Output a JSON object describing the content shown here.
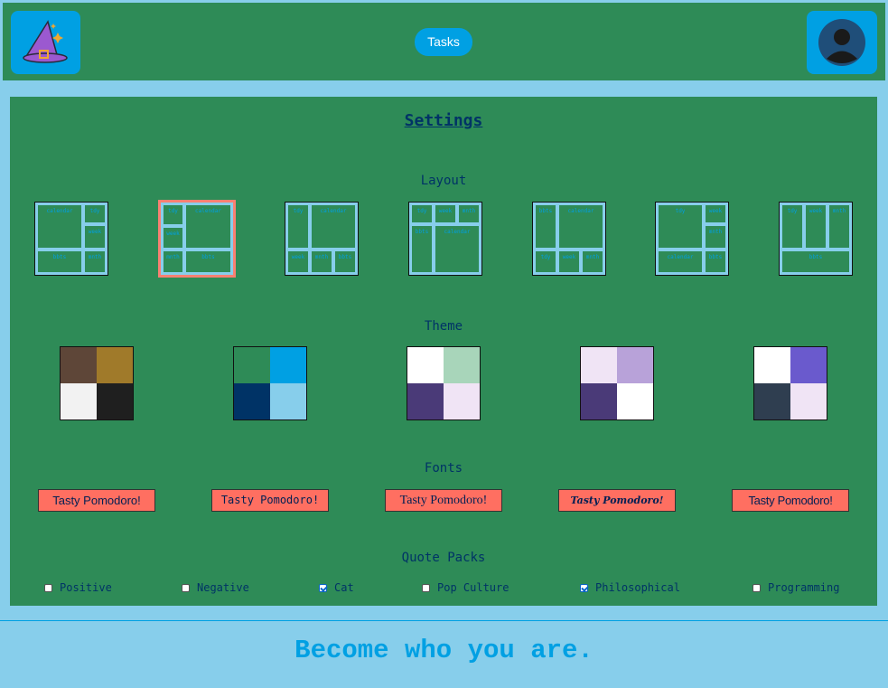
{
  "header": {
    "logo_icon": "wizard-hat-icon",
    "tasks_label": "Tasks",
    "avatar_icon": "user-avatar-icon"
  },
  "settings": {
    "title": "Settings",
    "layout_title": "Layout",
    "theme_title": "Theme",
    "fonts_title": "Fonts",
    "quote_packs_title": "Quote Packs"
  },
  "layouts": [
    {
      "cells": [
        "calendar",
        "tdy",
        "week",
        "bbts",
        "mnth"
      ]
    },
    {
      "cells": [
        "tdy",
        "calendar",
        "week",
        "mnth",
        "bbts"
      ],
      "selected": true
    },
    {
      "cells": [
        "tdy",
        "calendar",
        "week",
        "mnth",
        "bbts"
      ]
    },
    {
      "cells": [
        "tdy",
        "week",
        "mnth",
        "bbts",
        "calendar"
      ]
    },
    {
      "cells": [
        "bbts",
        "calendar",
        "tdy",
        "week",
        "mnth"
      ]
    },
    {
      "cells": [
        "tdy",
        "week",
        "mnth",
        "calendar",
        "bbts"
      ]
    },
    {
      "cells": [
        "tdy",
        "week",
        "mnth",
        "bbts"
      ]
    }
  ],
  "themes": [
    {
      "colors": [
        "#5e4638",
        "#a07a2a",
        "#f2f2f2",
        "#1f1f1f"
      ]
    },
    {
      "colors": [
        "#2e8b57",
        "#00a0e3",
        "#003366",
        "#87ceeb"
      ]
    },
    {
      "colors": [
        "#ffffff",
        "#a8d5ba",
        "#4a3a78",
        "#f0e4f5"
      ]
    },
    {
      "colors": [
        "#f0e4f5",
        "#b8a2d9",
        "#4a3a78",
        "#ffffff"
      ]
    },
    {
      "colors": [
        "#ffffff",
        "#6a5acd",
        "#2f3e50",
        "#f0e4f5"
      ]
    }
  ],
  "fonts": [
    {
      "label": "Tasty Pomodoro!"
    },
    {
      "label": "Tasty Pomodoro!"
    },
    {
      "label": "Tasty Pomodoro!"
    },
    {
      "label": "Tasty Pomodoro!"
    },
    {
      "label": "Tasty Pomodoro!"
    }
  ],
  "quote_packs": [
    {
      "label": "Positive",
      "checked": false
    },
    {
      "label": "Negative",
      "checked": false
    },
    {
      "label": "Cat",
      "checked": true
    },
    {
      "label": "Pop Culture",
      "checked": false
    },
    {
      "label": "Philosophical",
      "checked": true
    },
    {
      "label": "Programming",
      "checked": false
    }
  ],
  "footer": {
    "quote": "Become who you are."
  },
  "colors": {
    "background": "#87ceeb",
    "panel": "#2e8b57",
    "accent": "#00a0e3",
    "font_button": "#ff6f61",
    "selected_border": "#fa8072",
    "heading_text": "#003366"
  }
}
